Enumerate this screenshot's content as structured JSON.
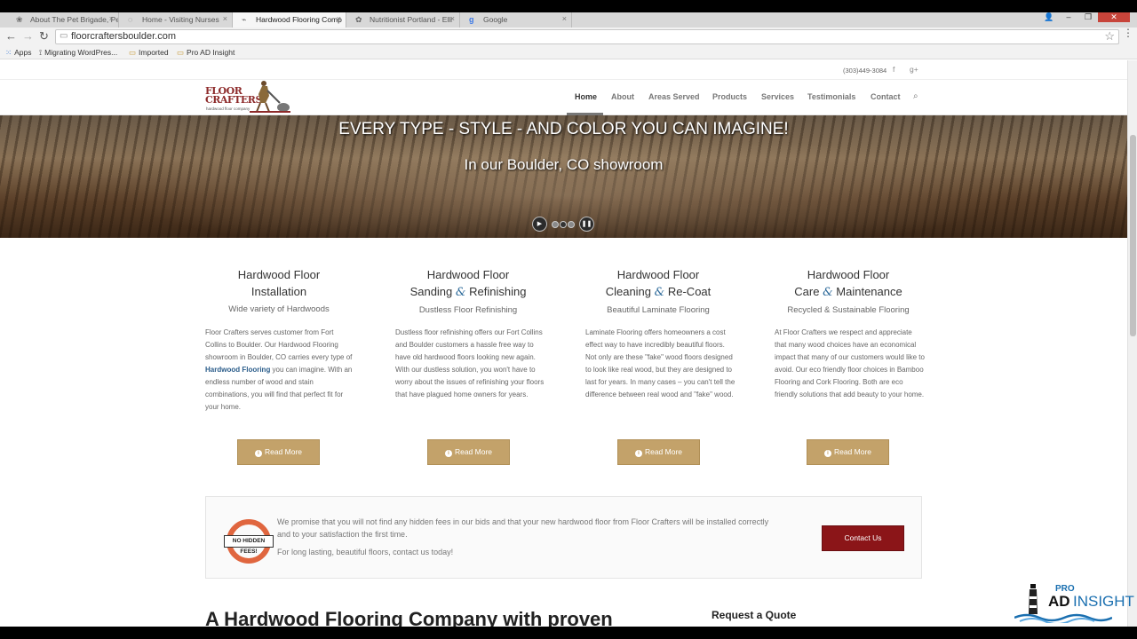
{
  "browser": {
    "tabs": [
      {
        "title": "About The Pet Brigade, Pe",
        "icon": "paw-icon"
      },
      {
        "title": "Home - Visiting Nurses",
        "icon": "globe-icon"
      },
      {
        "title": "Hardwood Flooring Comp",
        "icon": "floor-icon"
      },
      {
        "title": "Nutritionist Portland - Elli",
        "icon": "leaf-icon"
      },
      {
        "title": "Google",
        "icon": "google-icon"
      }
    ],
    "url": "floorcraftersboulder.com",
    "bookmarks": [
      {
        "label": "Apps",
        "icon": "apps-grid-icon"
      },
      {
        "label": "Migrating WordPres...",
        "icon": "wordpress-icon"
      },
      {
        "label": "Imported",
        "icon": "folder-icon"
      },
      {
        "label": "Pro AD Insight",
        "icon": "folder-icon"
      }
    ]
  },
  "site": {
    "phone": "(303)449-3084",
    "logo": {
      "line1": "FLOOR",
      "line2": "CRAFTERS",
      "tagline": "hardwood floor company"
    },
    "nav": [
      "Home",
      "About",
      "Areas Served",
      "Products",
      "Services",
      "Testimonials",
      "Contact"
    ],
    "hero": {
      "title": "EVERY TYPE - STYLE - AND COLOR YOU CAN IMAGINE!",
      "subtitle": "In our Boulder, CO showroom"
    },
    "services": [
      {
        "title_line1": "Hardwood Floor",
        "title_line2_a": "Installation",
        "title_line2_amp": "",
        "title_line2_b": "",
        "subtitle": "Wide variety of Hardwoods",
        "body_pre": "Floor Crafters serves customer from Fort Collins to Boulder.  Our Hardwood Flooring showroom in Boulder, CO carries every type of ",
        "body_link": "Hardwood Flooring",
        "body_post": " you can imagine.   With an endless number of wood and stain combinations, you will find that perfect fit for your home.",
        "button": "Read More"
      },
      {
        "title_line1": "Hardwood Floor",
        "title_line2_a": "Sanding",
        "title_line2_amp": "&",
        "title_line2_b": "Refinishing",
        "subtitle": "Dustless Floor Refinishing",
        "body_pre": "Dustless floor refinishing offers our Fort Collins and Boulder customers a hassle free way to have old hardwood floors looking new again.  With our dustless solution, you won't have to worry about the issues of refinishing your floors that have plagued home owners for years.",
        "body_link": "",
        "body_post": "",
        "button": "Read More"
      },
      {
        "title_line1": "Hardwood Floor",
        "title_line2_a": "Cleaning",
        "title_line2_amp": "&",
        "title_line2_b": "Re-Coat",
        "subtitle": "Beautiful Laminate Flooring",
        "body_pre": "Laminate Flooring offers homeowners a cost effect way to have incredibly beautiful floors.  Not only are these \"fake\" wood floors designed to look like real wood, but they are designed to last for years.  In many cases – you can't tell the difference between real wood and \"fake\" wood.",
        "body_link": "",
        "body_post": "",
        "button": "Read More"
      },
      {
        "title_line1": "Hardwood Floor",
        "title_line2_a": "Care",
        "title_line2_amp": "&",
        "title_line2_b": "Maintenance",
        "subtitle": "Recycled & Sustainable Flooring",
        "body_pre": "At Floor Crafters we respect and appreciate that many wood choices have an economical impact that many of our customers would like to avoid.  Our eco friendly floor choices in Bamboo Flooring and Cork Flooring.  Both are eco friendly solutions that add beauty to your home.",
        "body_link": "",
        "body_post": "",
        "button": "Read More"
      }
    ],
    "promise": {
      "badge": "NO HIDDEN FEES!",
      "text": "We promise that you will not find any hidden fees in our bids and that your new hardwood floor from Floor Crafters will be installed correctly and to your satisfaction the first time.",
      "text2": "For long lasting, beautiful floors, contact us today!",
      "button": "Contact Us"
    },
    "bottom_heading": "A Hardwood Flooring Company with proven",
    "quote_heading": "Request a Quote"
  },
  "watermark": {
    "pro": "PRO",
    "ad": "AD",
    "insight": "INSIGHT"
  },
  "colors": {
    "gold": "#c3a26a",
    "maroon": "#8b1518",
    "logo_red": "#8d2a2a",
    "link_blue": "#2a5c8a"
  }
}
